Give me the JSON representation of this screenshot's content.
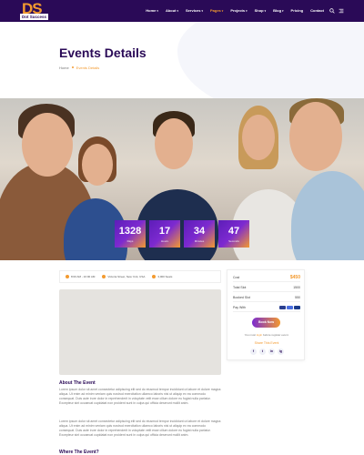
{
  "brand": {
    "logo_letters": "DS",
    "logo_subtitle": "Dot Success"
  },
  "nav": [
    {
      "label": "Home",
      "has_dropdown": true,
      "active": false
    },
    {
      "label": "About",
      "has_dropdown": true,
      "active": false
    },
    {
      "label": "Services",
      "has_dropdown": true,
      "active": false
    },
    {
      "label": "Pages",
      "has_dropdown": true,
      "active": true
    },
    {
      "label": "Projects",
      "has_dropdown": true,
      "active": false
    },
    {
      "label": "Shop",
      "has_dropdown": true,
      "active": false
    },
    {
      "label": "Blog",
      "has_dropdown": true,
      "active": false
    },
    {
      "label": "Pricing",
      "has_dropdown": false,
      "active": false
    },
    {
      "label": "Contact",
      "has_dropdown": false,
      "active": false
    }
  ],
  "header_icons": [
    "search-icon",
    "menu-icon"
  ],
  "page": {
    "title": "Events Details",
    "breadcrumb": {
      "home": "Home",
      "current": "Events Details"
    }
  },
  "countdown": [
    {
      "value": "1328",
      "label": "Days"
    },
    {
      "value": "17",
      "label": "Hours"
    },
    {
      "value": "34",
      "label": "Minutes"
    },
    {
      "value": "47",
      "label": "Seconds"
    }
  ],
  "event_meta": {
    "time": "8:00 AM - 10:00 AM",
    "location": "Victoria Street, New York, USA",
    "attendees": "3,000 Seats"
  },
  "about": {
    "heading": "About The Event",
    "paragraph_1": "Lorem ipsum dolor sit amet consectetur adipiscing elit sed do eiusmod tempor incididunt ut labore et dolore magna aliqua. Ut enim ad minim veniam quis nostrud exercitation ullamco laboris nisi ut aliquip ex ea commodo consequat. Duis aute irure dolor in reprehenderit in voluptate velit esse cillum dolore eu fugiat nulla pariatur. Excepteur sint occaecat cupidatat non proident sunt in culpa qui officia deserunt mollit anim.",
    "paragraph_2": "Lorem ipsum dolor sit amet consectetur adipiscing elit sed do eiusmod tempor incididunt ut labore et dolore magna aliqua. Ut enim ad minim veniam quis nostrud exercitation ullamco laboris nisi ut aliquip ex ea commodo consequat. Duis aute irure dolor in reprehenderit in voluptate velit esse cillum dolore eu fugiat nulla pariatur. Excepteur sint occaecat cupidatat non proident sunt in culpa qui officia deserunt mollit anim."
  },
  "where": {
    "heading": "Where The Event?"
  },
  "ticket": {
    "cost_label": "Cost",
    "cost_value": "$450",
    "total_label": "Total Slot",
    "total_value": "1500",
    "booked_label": "Booked Slot",
    "booked_value": "550",
    "pay_label": "Pay With",
    "pay_icons": [
      "visa-icon",
      "mastercard-icon",
      "amex-icon"
    ],
    "book_button": "Book Now",
    "login_prefix": "You must",
    "login_link": "login",
    "login_suffix": "before register event.",
    "share_label": "Share This Event"
  },
  "socials": [
    {
      "icon": "facebook-icon",
      "glyph": "f"
    },
    {
      "icon": "twitter-icon",
      "glyph": "t"
    },
    {
      "icon": "linkedin-icon",
      "glyph": "in"
    },
    {
      "icon": "instagram-icon",
      "glyph": "ig"
    }
  ],
  "colors": {
    "primary": "#2a0a57",
    "accent": "#f39a2f",
    "gradient_start": "#5d1db8"
  }
}
